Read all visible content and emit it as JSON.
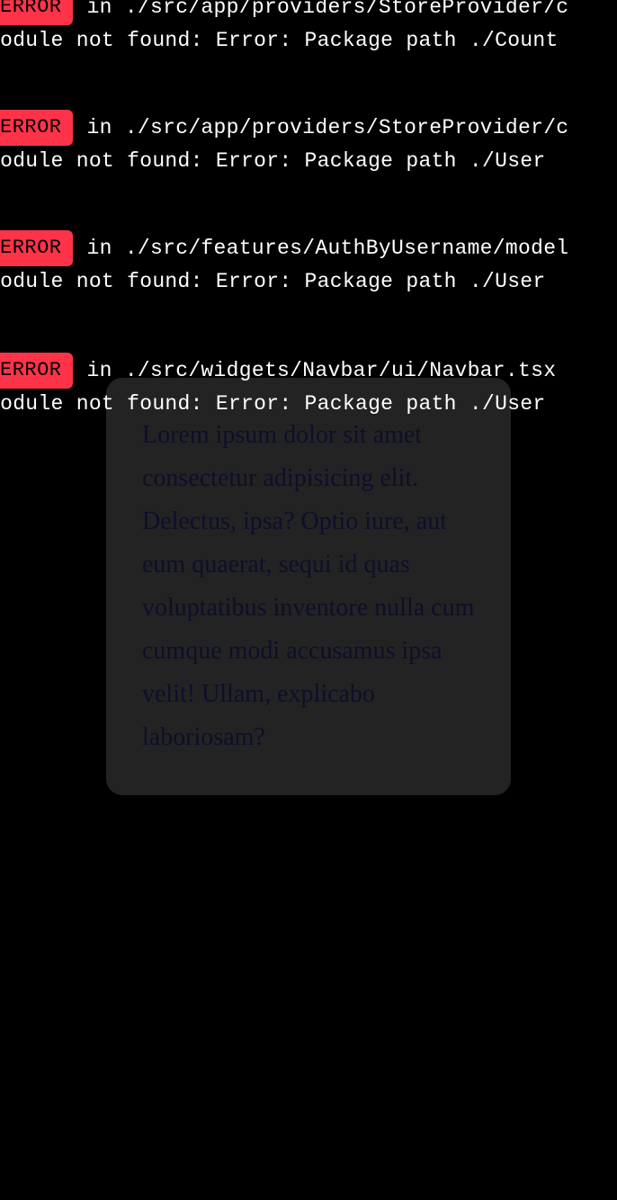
{
  "overlay": {
    "errors": [
      {
        "badge": "ERROR",
        "path": "in ./src/app/providers/StoreProvider/c",
        "message": "Module not found: Error: Package path ./Count"
      },
      {
        "badge": "ERROR",
        "path": "in ./src/app/providers/StoreProvider/c",
        "message": "Module not found: Error: Package path ./User"
      },
      {
        "badge": "ERROR",
        "path": "in ./src/features/AuthByUsername/model",
        "message": "Module not found: Error: Package path ./User"
      },
      {
        "badge": "ERROR",
        "path": "in ./src/widgets/Navbar/ui/Navbar.tsx",
        "message": "Module not found: Error: Package path ./User"
      }
    ]
  },
  "modal": {
    "text": "Lorem ipsum dolor sit amet consectetur adipisicing elit. Delectus, ipsa? Optio iure, aut eum quaerat, sequi id quas voluptatibus inventore nulla cum cumque modi accusamus ipsa velit! Ullam, explicabo laboriosam?"
  },
  "colors": {
    "background": "#000000",
    "error_badge": "#ff3348",
    "modal_background": "#232323",
    "modal_text": "#0d0f2a"
  }
}
